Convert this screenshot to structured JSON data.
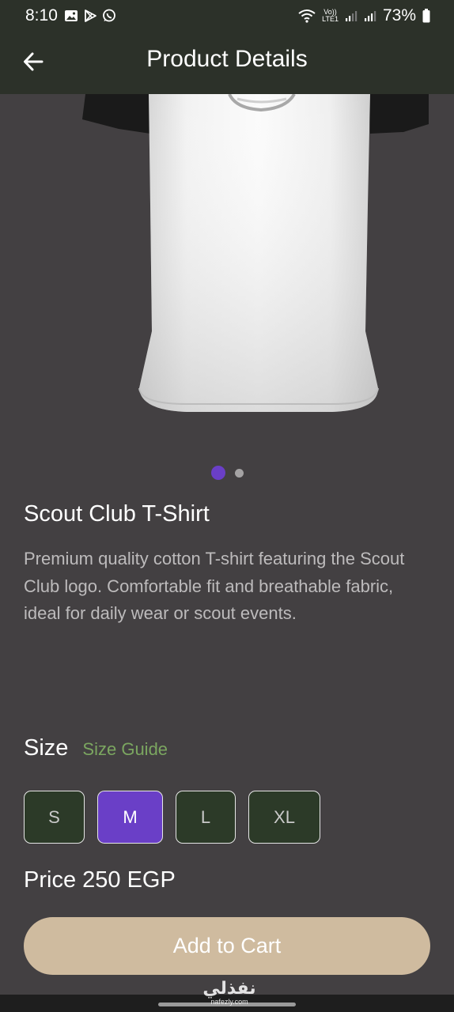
{
  "status_bar": {
    "time": "8:10",
    "network_label_top": "Vo))",
    "network_label_bottom": "LTE1",
    "battery": "73%"
  },
  "app_bar": {
    "title": "Product Details"
  },
  "carousel": {
    "page_count": 2,
    "active_index": 0
  },
  "product": {
    "name": "Scout Club T-Shirt",
    "description": "Premium quality cotton T-shirt featuring the Scout Club logo. Comfortable fit and breathable fabric, ideal for daily wear or scout events.",
    "price": "Price 250 EGP"
  },
  "size": {
    "label": "Size",
    "guide_label": "Size Guide",
    "options": [
      "S",
      "M",
      "L",
      "XL"
    ],
    "selected": "M"
  },
  "actions": {
    "add_to_cart": "Add to Cart"
  },
  "watermark": {
    "arabic": "نفذلي",
    "latin": "nafezly.com"
  },
  "colors": {
    "background": "#434042",
    "app_bar": "#2c3129",
    "accent": "#6a3fc7",
    "size_guide": "#7ba660",
    "cart_button": "#cfbb9f"
  }
}
